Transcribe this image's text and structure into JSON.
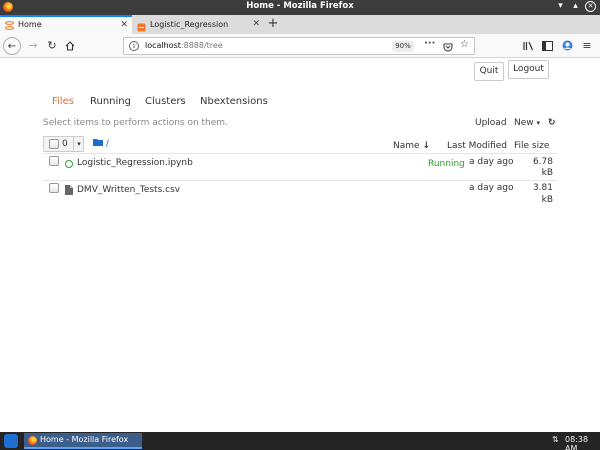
{
  "window": {
    "title": "Home - Mozilla Firefox"
  },
  "tabs": [
    {
      "label": "Home",
      "active": true
    },
    {
      "label": "Logistic_Regression",
      "active": false
    }
  ],
  "new_tab_label": "+",
  "url": {
    "host": "localhost",
    "path": ":8888/tree",
    "zoom": "90%"
  },
  "page": {
    "header_buttons": {
      "quit": "Quit",
      "logout": "Logout"
    },
    "nav_tabs": [
      {
        "label": "Files",
        "active": true
      },
      {
        "label": "Running",
        "active": false
      },
      {
        "label": "Clusters",
        "active": false
      },
      {
        "label": "Nbextensions",
        "active": false
      }
    ],
    "hint": "Select items to perform actions on them.",
    "actions": {
      "upload": "Upload",
      "new": "New",
      "new_caret": "▾",
      "refresh": "↻"
    },
    "selection": {
      "count": "0",
      "caret": "▾",
      "breadcrumb_sep": "/"
    },
    "columns": {
      "name": "Name",
      "name_sort": "↓",
      "last_modified": "Last Modified",
      "file_size": "File size"
    },
    "files": [
      {
        "name": "Logistic_Regression.ipynb",
        "type": "notebook",
        "status": "Running",
        "modified": "a day ago",
        "size_value": "6.78",
        "size_unit": "kB"
      },
      {
        "name": "DMV_Written_Tests.csv",
        "type": "file",
        "status": "",
        "modified": "a day ago",
        "size_value": "3.81",
        "size_unit": "kB"
      }
    ]
  },
  "taskbar": {
    "task_label": "Home - Mozilla Firefox",
    "clock": "08:38 AM"
  },
  "colors": {
    "accent": "#e46d2b",
    "running": "#2e9e2e",
    "folder": "#1e6fd0",
    "tab_highlight": "#0a84ff"
  },
  "icons": [
    "firefox-icon",
    "close-icon",
    "back-icon",
    "forward-icon",
    "reload-icon",
    "home-icon",
    "info-icon",
    "more-icon",
    "pocket-icon",
    "star-icon",
    "library-icon",
    "sidebar-icon",
    "account-icon",
    "menu-icon",
    "folder-icon",
    "notebook-icon",
    "file-icon",
    "refresh-icon"
  ]
}
